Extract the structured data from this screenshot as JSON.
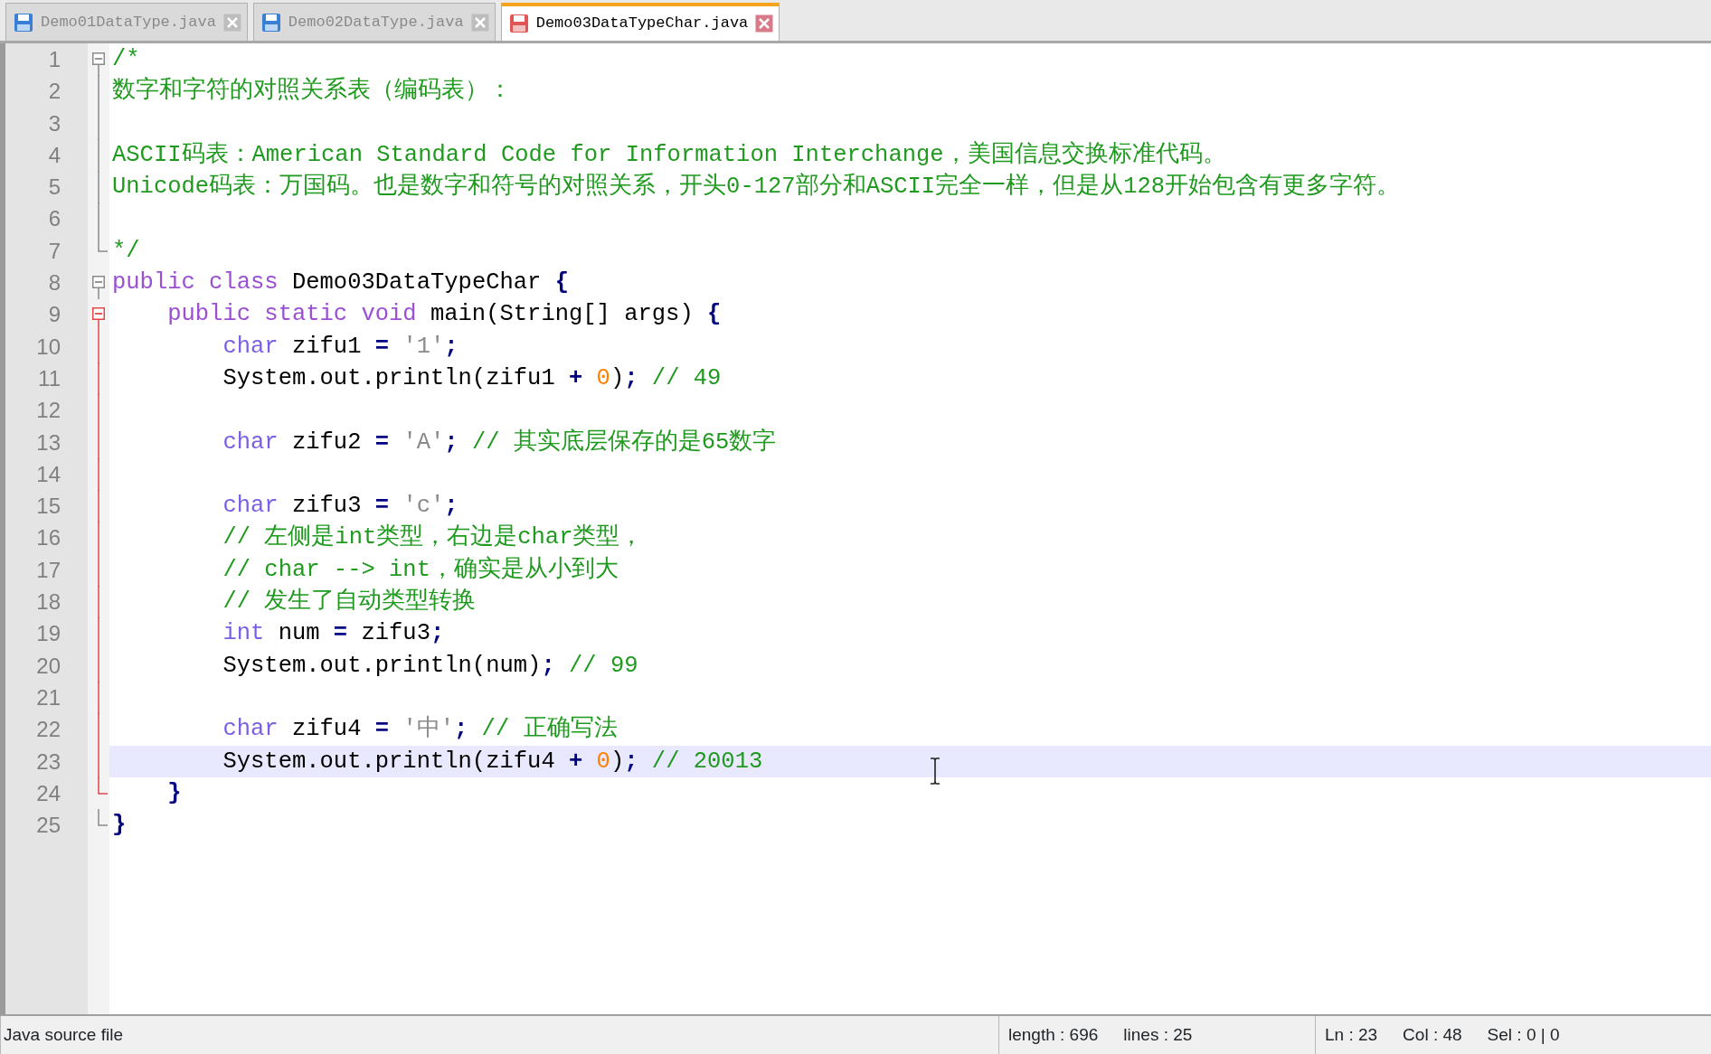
{
  "tabs": [
    {
      "label": "Demo01DataType.java",
      "selected": false
    },
    {
      "label": "Demo02DataType.java",
      "selected": false
    },
    {
      "label": "Demo03DataTypeChar.java",
      "selected": true
    }
  ],
  "editor": {
    "lines": [
      {
        "number": "1",
        "current": false,
        "fold": {
          "kind": "start",
          "active": false
        },
        "tokens": [
          {
            "kind": "comment",
            "text": "/*"
          }
        ]
      },
      {
        "number": "2",
        "current": false,
        "fold": {
          "kind": "mid",
          "active": false
        },
        "tokens": [
          {
            "kind": "comment",
            "text": "数字和字符的对照关系表（编码表）："
          }
        ]
      },
      {
        "number": "3",
        "current": false,
        "fold": {
          "kind": "mid",
          "active": false
        }
      },
      {
        "number": "4",
        "current": false,
        "fold": {
          "kind": "mid",
          "active": false
        },
        "tokens": [
          {
            "kind": "comment",
            "text": "ASCII码表：American Standard Code for Information Interchange，美国信息交换标准代码。"
          }
        ]
      },
      {
        "number": "5",
        "current": false,
        "fold": {
          "kind": "mid",
          "active": false
        },
        "tokens": [
          {
            "kind": "comment",
            "text": "Unicode码表：万国码。也是数字和符号的对照关系，开头0-127部分和ASCII完全一样，但是从128开始包含有更多字符。"
          }
        ]
      },
      {
        "number": "6",
        "current": false,
        "fold": {
          "kind": "mid",
          "active": false
        }
      },
      {
        "number": "7",
        "current": false,
        "fold": {
          "kind": "end",
          "active": false
        },
        "tokens": [
          {
            "kind": "comment",
            "text": "*/"
          }
        ]
      },
      {
        "number": "8",
        "current": false,
        "fold": {
          "kind": "start",
          "active": false
        },
        "tokens": [
          {
            "kind": "keyword",
            "text": "public class"
          },
          {
            "kind": "plain",
            "text": " Demo03DataTypeChar "
          },
          {
            "kind": "op",
            "text": "{"
          }
        ]
      },
      {
        "number": "9",
        "current": false,
        "fold": {
          "kind": "start",
          "active": true
        },
        "tokens": [
          {
            "kind": "keyword",
            "text": "    public static void"
          },
          {
            "kind": "plain",
            "text": " main(String[] args) "
          },
          {
            "kind": "op",
            "text": "{"
          }
        ]
      },
      {
        "number": "10",
        "current": false,
        "fold": {
          "kind": "mid",
          "active": true
        },
        "tokens": [
          {
            "kind": "type",
            "text": "        char"
          },
          {
            "kind": "plain",
            "text": " zifu1 "
          },
          {
            "kind": "op",
            "text": "= "
          },
          {
            "kind": "string",
            "text": "'1'"
          },
          {
            "kind": "op",
            "text": ";"
          }
        ]
      },
      {
        "number": "11",
        "current": false,
        "fold": {
          "kind": "mid",
          "active": true
        },
        "tokens": [
          {
            "kind": "plain",
            "text": "        System.out.println(zifu1 "
          },
          {
            "kind": "op",
            "text": "+ "
          },
          {
            "kind": "number",
            "text": "0"
          },
          {
            "kind": "plain",
            "text": ")"
          },
          {
            "kind": "op",
            "text": "; "
          },
          {
            "kind": "comment",
            "text": "// 49"
          }
        ]
      },
      {
        "number": "12",
        "current": false,
        "fold": {
          "kind": "mid",
          "active": true
        }
      },
      {
        "number": "13",
        "current": false,
        "fold": {
          "kind": "mid",
          "active": true
        },
        "tokens": [
          {
            "kind": "type",
            "text": "        char"
          },
          {
            "kind": "plain",
            "text": " zifu2 "
          },
          {
            "kind": "op",
            "text": "= "
          },
          {
            "kind": "string",
            "text": "'A'"
          },
          {
            "kind": "op",
            "text": "; "
          },
          {
            "kind": "comment",
            "text": "// 其实底层保存的是65数字"
          }
        ]
      },
      {
        "number": "14",
        "current": false,
        "fold": {
          "kind": "mid",
          "active": true
        }
      },
      {
        "number": "15",
        "current": false,
        "fold": {
          "kind": "mid",
          "active": true
        },
        "tokens": [
          {
            "kind": "type",
            "text": "        char"
          },
          {
            "kind": "plain",
            "text": " zifu3 "
          },
          {
            "kind": "op",
            "text": "= "
          },
          {
            "kind": "string",
            "text": "'c'"
          },
          {
            "kind": "op",
            "text": ";"
          }
        ]
      },
      {
        "number": "16",
        "current": false,
        "fold": {
          "kind": "mid",
          "active": true
        },
        "tokens": [
          {
            "kind": "comment",
            "text": "        // 左侧是int类型，右边是char类型，"
          }
        ]
      },
      {
        "number": "17",
        "current": false,
        "fold": {
          "kind": "mid",
          "active": true
        },
        "tokens": [
          {
            "kind": "comment",
            "text": "        // char --> int，确实是从小到大"
          }
        ]
      },
      {
        "number": "18",
        "current": false,
        "fold": {
          "kind": "mid",
          "active": true
        },
        "tokens": [
          {
            "kind": "comment",
            "text": "        // 发生了自动类型转换"
          }
        ]
      },
      {
        "number": "19",
        "current": false,
        "fold": {
          "kind": "mid",
          "active": true
        },
        "tokens": [
          {
            "kind": "type",
            "text": "        int"
          },
          {
            "kind": "plain",
            "text": " num "
          },
          {
            "kind": "op",
            "text": "= "
          },
          {
            "kind": "plain",
            "text": "zifu3"
          },
          {
            "kind": "op",
            "text": ";"
          }
        ]
      },
      {
        "number": "20",
        "current": false,
        "fold": {
          "kind": "mid",
          "active": true
        },
        "tokens": [
          {
            "kind": "plain",
            "text": "        System.out.println(num)"
          },
          {
            "kind": "op",
            "text": "; "
          },
          {
            "kind": "comment",
            "text": "// 99"
          }
        ]
      },
      {
        "number": "21",
        "current": false,
        "fold": {
          "kind": "mid",
          "active": true
        }
      },
      {
        "number": "22",
        "current": false,
        "fold": {
          "kind": "mid",
          "active": true
        },
        "tokens": [
          {
            "kind": "type",
            "text": "        char"
          },
          {
            "kind": "plain",
            "text": " zifu4 "
          },
          {
            "kind": "op",
            "text": "= "
          },
          {
            "kind": "string",
            "text": "'中'"
          },
          {
            "kind": "op",
            "text": "; "
          },
          {
            "kind": "comment",
            "text": "// 正确写法"
          }
        ]
      },
      {
        "number": "23",
        "current": true,
        "fold": {
          "kind": "mid",
          "active": true
        },
        "tokens": [
          {
            "kind": "plain",
            "text": "        System.out.println(zifu4 "
          },
          {
            "kind": "op",
            "text": "+ "
          },
          {
            "kind": "number",
            "text": "0"
          },
          {
            "kind": "plain",
            "text": ")"
          },
          {
            "kind": "op",
            "text": "; "
          },
          {
            "kind": "comment",
            "text": "// 20013"
          }
        ]
      },
      {
        "number": "24",
        "current": false,
        "fold": {
          "kind": "end",
          "active": true
        },
        "tokens": [
          {
            "kind": "op",
            "text": "    }"
          }
        ]
      },
      {
        "number": "25",
        "current": false,
        "fold": {
          "kind": "end",
          "active": false
        },
        "tokens": [
          {
            "kind": "op",
            "text": "}"
          }
        ]
      }
    ]
  },
  "status_bar": {
    "file_type": "Java source file",
    "sections": [
      {
        "items": [
          "length : 696",
          "lines : 25"
        ]
      },
      {
        "items": [
          "Ln : 23",
          "Col : 48",
          "Sel : 0 | 0"
        ]
      }
    ]
  }
}
